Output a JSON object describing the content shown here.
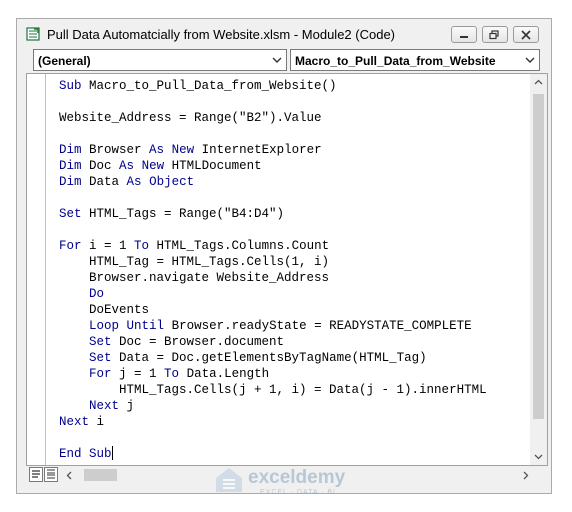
{
  "window": {
    "title": "Pull Data Automatcially from Website.xlsm - Module2 (Code)"
  },
  "dropdowns": {
    "object": "(General)",
    "procedure": "Macro_to_Pull_Data_from_Website"
  },
  "code_lines": [
    "Sub Macro_to_Pull_Data_from_Website()",
    "",
    "Website_Address = Range(\"B2\").Value",
    "",
    "Dim Browser As New InternetExplorer",
    "Dim Doc As New HTMLDocument",
    "Dim Data As Object",
    "",
    "Set HTML_Tags = Range(\"B4:D4\")",
    "",
    "For i = 1 To HTML_Tags.Columns.Count",
    "    HTML_Tag = HTML_Tags.Cells(1, i)",
    "    Browser.navigate Website_Address",
    "    Do",
    "    DoEvents",
    "    Loop Until Browser.readyState = READYSTATE_COMPLETE",
    "    Set Doc = Browser.document",
    "    Set Data = Doc.getElementsByTagName(HTML_Tag)",
    "    For j = 1 To Data.Length",
    "        HTML_Tags.Cells(j + 1, i) = Data(j - 1).innerHTML",
    "    Next j",
    "Next i",
    "",
    "End Sub"
  ],
  "keywords": [
    "Sub",
    "End Sub",
    "Dim",
    "As",
    "New",
    "Object",
    "Set",
    "For",
    "To",
    "Next",
    "Do",
    "Loop",
    "Until"
  ],
  "watermark": {
    "name": "exceldemy",
    "tagline": "EXCEL · DATA · BI"
  },
  "colors": {
    "keyword": "#00008b",
    "text": "#000000",
    "window_bg": "#f0f0f0"
  }
}
